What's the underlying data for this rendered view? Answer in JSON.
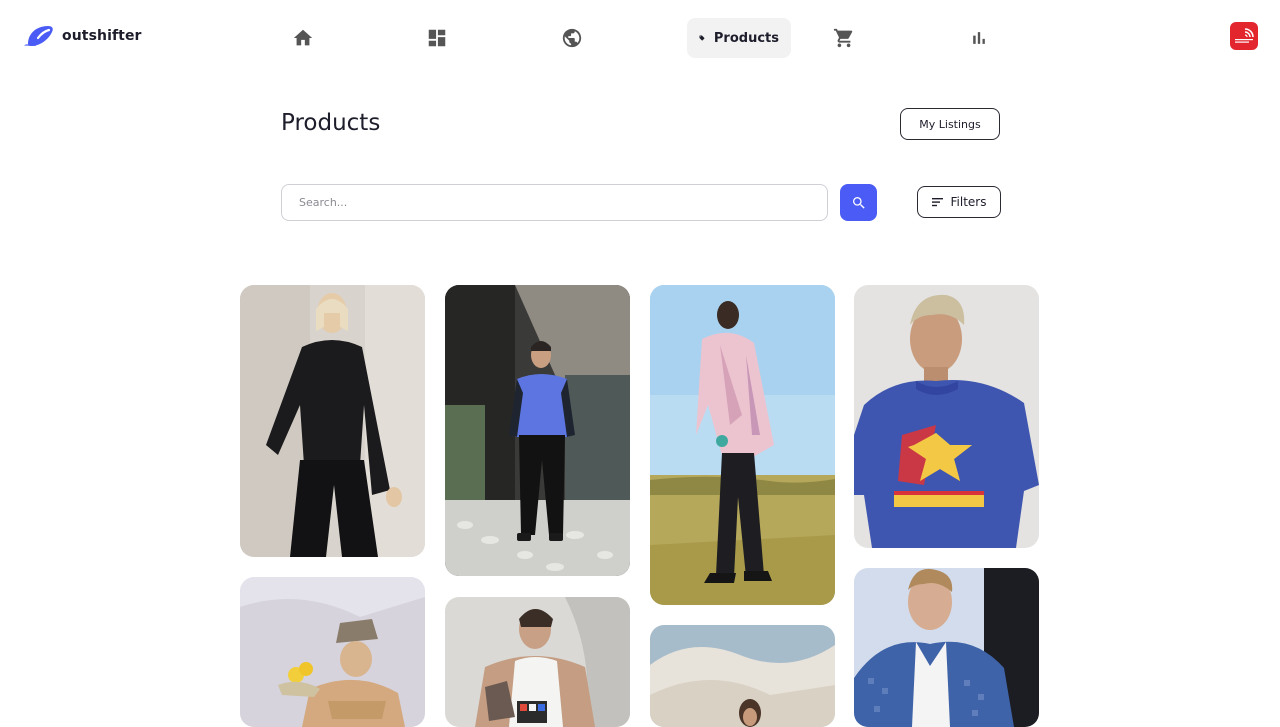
{
  "app": {
    "brand": "outshifter",
    "brand_color": "#4a5cf5"
  },
  "nav": {
    "items": [
      {
        "id": "home",
        "icon": "home-icon"
      },
      {
        "id": "dashboard",
        "icon": "dashboard-icon"
      },
      {
        "id": "globe",
        "icon": "globe-icon"
      },
      {
        "id": "products",
        "icon": "tag-icon",
        "label": "Products",
        "active": true
      },
      {
        "id": "cart",
        "icon": "cart-icon"
      },
      {
        "id": "analytics",
        "icon": "bar-chart-icon"
      }
    ],
    "store_badge": {
      "icon": "the-north-face-logo",
      "color": "#e3262d"
    }
  },
  "main": {
    "title": "Products",
    "my_listings_label": "My Listings",
    "search": {
      "placeholder": "Search...",
      "value": ""
    },
    "search_button_icon": "search-icon",
    "filters_label": "Filters",
    "filters_icon": "filter-lines-icon"
  },
  "products": [
    {
      "image": "woman-black-shirt-and-trousers"
    },
    {
      "image": "man-blue-top-black-trousers-on-pebbles"
    },
    {
      "image": "man-pink-shirt-in-field"
    },
    {
      "image": "man-blue-starter-tshirt"
    },
    {
      "image": "woman-bucket-hat-with-lemons"
    },
    {
      "image": "man-white-tank-top-rubiks-cube"
    },
    {
      "image": "woman-near-sand-dunes"
    },
    {
      "image": "man-blue-patterned-jacket"
    }
  ]
}
